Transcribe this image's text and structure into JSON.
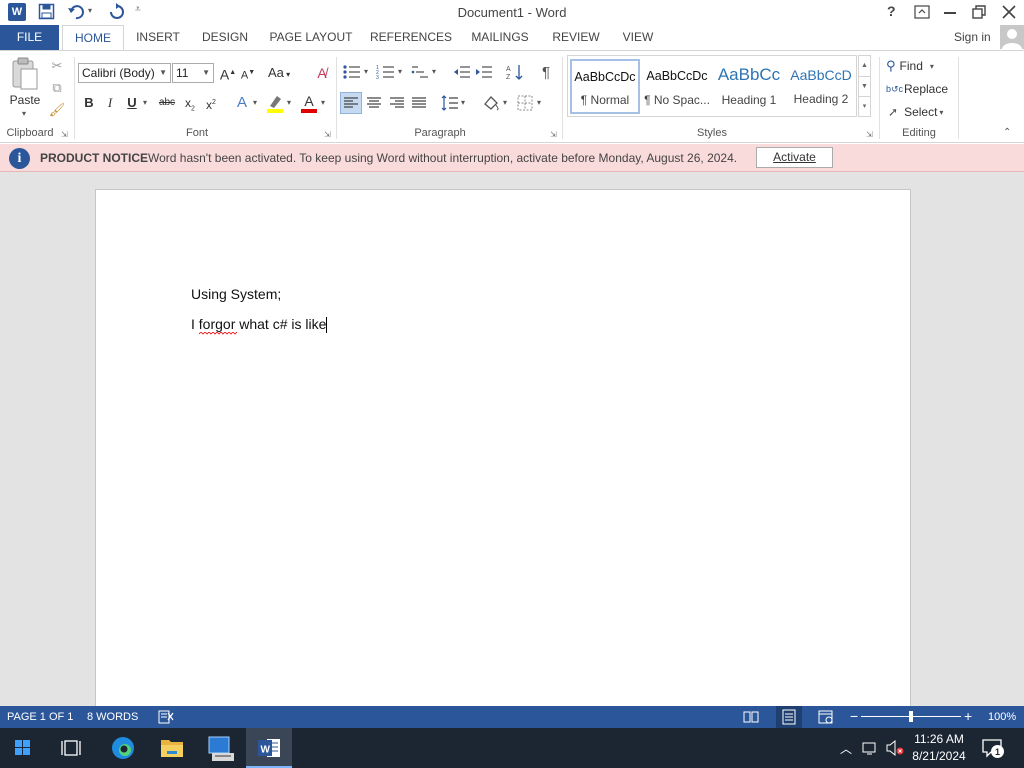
{
  "titlebar": {
    "title": "Document1 - Word",
    "help": "?"
  },
  "tabs": [
    "FILE",
    "HOME",
    "INSERT",
    "DESIGN",
    "PAGE LAYOUT",
    "REFERENCES",
    "MAILINGS",
    "REVIEW",
    "VIEW"
  ],
  "signin": "Sign in",
  "clipboard": {
    "paste": "Paste",
    "label": "Clipboard"
  },
  "font": {
    "name": "Calibri (Body)",
    "size": "11",
    "label": "Font",
    "case": "Aa"
  },
  "paragraph": {
    "label": "Paragraph"
  },
  "styles": {
    "label": "Styles",
    "items": [
      {
        "preview": "AaBbCcDc",
        "name": "¶ Normal"
      },
      {
        "preview": "AaBbCcDc",
        "name": "¶ No Spac..."
      },
      {
        "preview": "AaBbCc",
        "name": "Heading 1"
      },
      {
        "preview": "AaBbCcD",
        "name": "Heading 2"
      }
    ]
  },
  "editing": {
    "find": "Find",
    "replace": "Replace",
    "select": "Select",
    "label": "Editing"
  },
  "notice": {
    "title": "PRODUCT NOTICE",
    "message": "Word hasn't been activated. To keep using Word without interruption, activate before Monday, August 26, 2024.",
    "button": "Activate"
  },
  "document": {
    "lines": [
      "Using System;",
      "I forgor what c# is like"
    ]
  },
  "status": {
    "page": "PAGE 1 OF 1",
    "words": "8 WORDS",
    "zoom": "100%",
    "zoom_fraction": 0.5
  },
  "taskbar": {
    "time": "11:26 AM",
    "date": "8/21/2024",
    "notif_count": "1"
  },
  "colors": {
    "accent": "#2b579a",
    "notice_bg": "#fadbdb",
    "taskbar": "#1c2633"
  }
}
